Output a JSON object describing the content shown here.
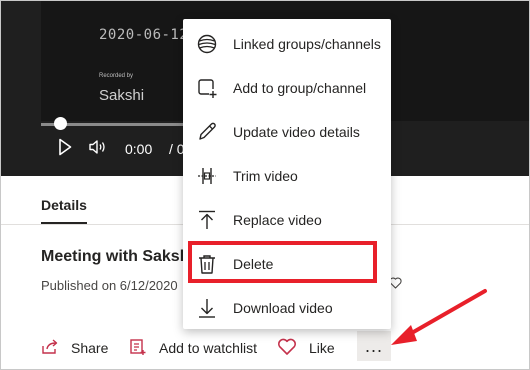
{
  "video": {
    "overlay_date": "2020-06-12 1",
    "overlay_recorded_by": "Recorded by",
    "overlay_name": "Sakshi",
    "time_current": "0:00",
    "time_rest": "/ 0:",
    "progress": 0.0
  },
  "details": {
    "tab_label": "Details",
    "title": "Meeting with Saksh",
    "published": "Published on 6/12/2020",
    "published_tail": "0"
  },
  "actions": {
    "share_label": "Share",
    "watchlist_label": "Add to watchlist",
    "like_label": "Like",
    "more_label": "..."
  },
  "menu": {
    "items": [
      {
        "label": "Linked groups/channels",
        "icon": "linked-groups-icon"
      },
      {
        "label": "Add to group/channel",
        "icon": "add-to-group-icon"
      },
      {
        "label": "Update video details",
        "icon": "pencil-icon"
      },
      {
        "label": "Trim video",
        "icon": "trim-icon"
      },
      {
        "label": "Replace video",
        "icon": "upload-arrow-icon"
      },
      {
        "label": "Delete",
        "icon": "trash-icon"
      },
      {
        "label": "Download video",
        "icon": "download-arrow-icon"
      }
    ]
  },
  "colors": {
    "accent_pink": "#c4314b",
    "highlight_red": "#e8202a",
    "video_bg": "#1f1f1f"
  }
}
